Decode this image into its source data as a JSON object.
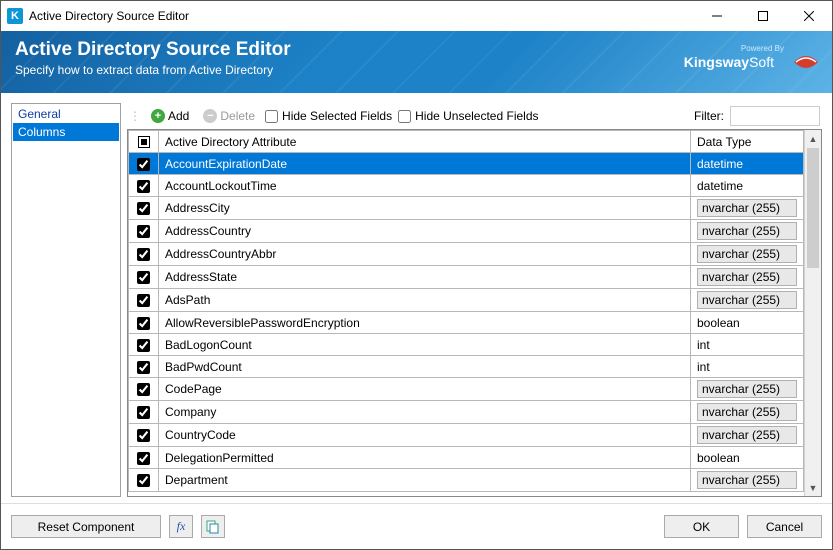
{
  "window": {
    "title": "Active Directory Source Editor"
  },
  "banner": {
    "heading": "Active Directory Source Editor",
    "sub": "Specify how to extract data from Active Directory",
    "powered_by": "Powered By",
    "logo_brand1": "Kingsway",
    "logo_brand2": "Soft"
  },
  "nav": {
    "general": "General",
    "columns": "Columns"
  },
  "toolbar": {
    "add": "Add",
    "delete": "Delete",
    "hide_selected": "Hide Selected Fields",
    "hide_unselected": "Hide Unselected Fields",
    "filter_label": "Filter:"
  },
  "headers": {
    "attribute": "Active Directory Attribute",
    "datatype": "Data Type"
  },
  "rows": [
    {
      "checked": true,
      "selected": true,
      "name": "AccountExpirationDate",
      "type": "datetime",
      "btn": false
    },
    {
      "checked": true,
      "selected": false,
      "name": "AccountLockoutTime",
      "type": "datetime",
      "btn": false
    },
    {
      "checked": true,
      "selected": false,
      "name": "AddressCity",
      "type": "nvarchar (255)",
      "btn": true
    },
    {
      "checked": true,
      "selected": false,
      "name": "AddressCountry",
      "type": "nvarchar (255)",
      "btn": true
    },
    {
      "checked": true,
      "selected": false,
      "name": "AddressCountryAbbr",
      "type": "nvarchar (255)",
      "btn": true
    },
    {
      "checked": true,
      "selected": false,
      "name": "AddressState",
      "type": "nvarchar (255)",
      "btn": true
    },
    {
      "checked": true,
      "selected": false,
      "name": "AdsPath",
      "type": "nvarchar (255)",
      "btn": true
    },
    {
      "checked": true,
      "selected": false,
      "name": "AllowReversiblePasswordEncryption",
      "type": "boolean",
      "btn": false
    },
    {
      "checked": true,
      "selected": false,
      "name": "BadLogonCount",
      "type": "int",
      "btn": false
    },
    {
      "checked": true,
      "selected": false,
      "name": "BadPwdCount",
      "type": "int",
      "btn": false
    },
    {
      "checked": true,
      "selected": false,
      "name": "CodePage",
      "type": "nvarchar (255)",
      "btn": true
    },
    {
      "checked": true,
      "selected": false,
      "name": "Company",
      "type": "nvarchar (255)",
      "btn": true
    },
    {
      "checked": true,
      "selected": false,
      "name": "CountryCode",
      "type": "nvarchar (255)",
      "btn": true
    },
    {
      "checked": true,
      "selected": false,
      "name": "DelegationPermitted",
      "type": "boolean",
      "btn": false
    },
    {
      "checked": true,
      "selected": false,
      "name": "Department",
      "type": "nvarchar (255)",
      "btn": true
    }
  ],
  "footer": {
    "reset": "Reset Component",
    "ok": "OK",
    "cancel": "Cancel"
  }
}
